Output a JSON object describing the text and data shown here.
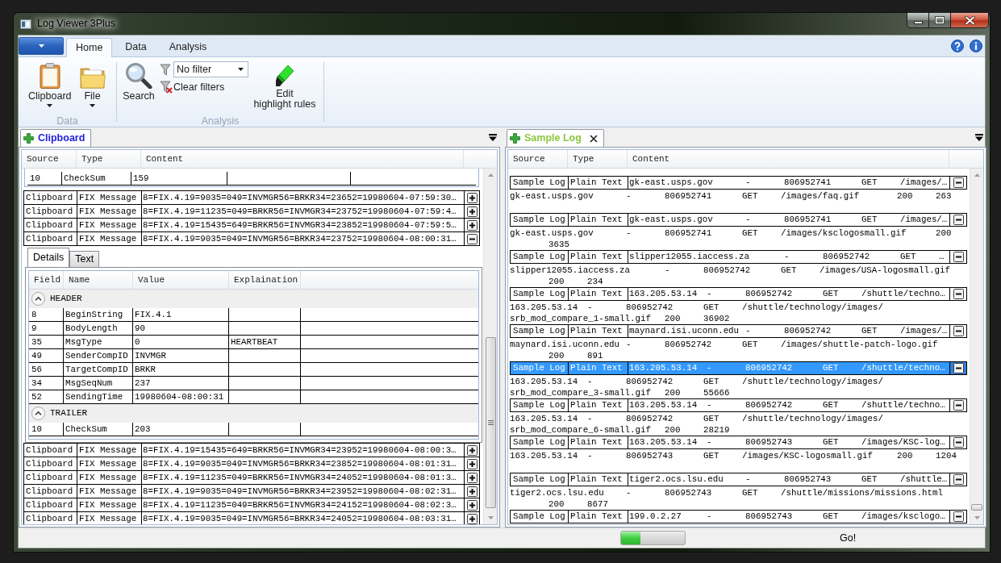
{
  "window": {
    "title": "Log Viewer 3Plus"
  },
  "ribbon": {
    "tabs": [
      {
        "label": "Home",
        "selected": true
      },
      {
        "label": "Data",
        "selected": false
      },
      {
        "label": "Analysis",
        "selected": false
      }
    ],
    "data_group": {
      "label": "Data",
      "buttons": [
        {
          "kind": "clipboard",
          "label": "Clipboard",
          "dropdown": true
        },
        {
          "kind": "folder",
          "label": "File",
          "dropdown": true
        }
      ]
    },
    "analysis_group": {
      "label": "Analysis",
      "search_button": {
        "label": "Search"
      },
      "filter_select": {
        "value": "No filter"
      },
      "clear_filters_button": {
        "label": "Clear filters"
      },
      "highlight_button": {
        "label": "Edit\nhighlight rules"
      }
    }
  },
  "left_pane": {
    "tab": {
      "label": "Clipboard",
      "color": "#1f1fdc",
      "closable": false
    },
    "columns": [
      "Source",
      "Type",
      "Content"
    ],
    "scrolled_detail_row": {
      "field": "10",
      "name": "CheckSum",
      "value": "159"
    },
    "messages": [
      {
        "source": "Clipboard",
        "type": "FIX Message",
        "content": "8=FIX.4.19=9035=049=INVMGR56=BRKR34=23652=19980604-07:59:30…",
        "expanded": false
      },
      {
        "source": "Clipboard",
        "type": "FIX Message",
        "content": "8=FIX.4.19=11235=049=BRKR56=INVMGR34=23752=19980604-07:59:4…",
        "expanded": false
      },
      {
        "source": "Clipboard",
        "type": "FIX Message",
        "content": "8=FIX.4.19=15435=649=BRKR56=INVMGR34=23852=19980604-07:59:5…",
        "expanded": false
      },
      {
        "source": "Clipboard",
        "type": "FIX Message",
        "content": "8=FIX.4.19=9035=049=INVMGR56=BRKR34=23752=19980604-08:00:31…",
        "expanded": true,
        "details": {
          "tabs": [
            {
              "label": "Details",
              "selected": true
            },
            {
              "label": "Text",
              "selected": false
            }
          ],
          "columns": [
            "Field",
            "Name",
            "Value",
            "Explaination"
          ],
          "groups": [
            {
              "label": "HEADER",
              "expanded": true,
              "rows": [
                {
                  "field": "8",
                  "name": "BeginString",
                  "value": "FIX.4.1"
                },
                {
                  "field": "9",
                  "name": "BodyLength",
                  "value": "90"
                },
                {
                  "field": "35",
                  "name": "MsgType",
                  "value": "0",
                  "explanation": "HEARTBEAT"
                },
                {
                  "field": "49",
                  "name": "SenderCompID",
                  "value": "INVMGR"
                },
                {
                  "field": "56",
                  "name": "TargetCompID",
                  "value": "BRKR"
                },
                {
                  "field": "34",
                  "name": "MsgSeqNum",
                  "value": "237"
                },
                {
                  "field": "52",
                  "name": "SendingTime",
                  "value": "19980604-08:00:31"
                }
              ]
            },
            {
              "label": "TRAILER",
              "expanded": true,
              "rows": [
                {
                  "field": "10",
                  "name": "CheckSum",
                  "value": "203"
                }
              ]
            }
          ]
        }
      },
      {
        "source": "Clipboard",
        "type": "FIX Message",
        "content": "8=FIX.4.19=15435=649=BRKR56=INVMGR34=23952=19980604-08:00:3…",
        "expanded": false
      },
      {
        "source": "Clipboard",
        "type": "FIX Message",
        "content": "8=FIX.4.19=9035=049=INVMGR56=BRKR34=23852=19980604-08:01:31…",
        "expanded": false
      },
      {
        "source": "Clipboard",
        "type": "FIX Message",
        "content": "8=FIX.4.19=11235=049=BRKR56=INVMGR34=24052=19980604-08:01:3…",
        "expanded": false
      },
      {
        "source": "Clipboard",
        "type": "FIX Message",
        "content": "8=FIX.4.19=9035=049=INVMGR56=BRKR34=23952=19980604-08:02:31…",
        "expanded": false
      },
      {
        "source": "Clipboard",
        "type": "FIX Message",
        "content": "8=FIX.4.19=11235=049=BRKR56=INVMGR34=24152=19980604-08:02:3…",
        "expanded": false
      },
      {
        "source": "Clipboard",
        "type": "FIX Message",
        "content": "8=FIX.4.19=9035=049=INVMGR56=BRKR34=24052=19980604-08:03:31…",
        "expanded": false
      }
    ]
  },
  "right_pane": {
    "tab": {
      "label": "Sample Log",
      "color": "#8cc63e",
      "closable": true
    },
    "columns": [
      "Source",
      "Type",
      "Content"
    ],
    "entries": [
      {
        "source": "Sample Log",
        "type": "Plain Text",
        "summary": "gk-east.usps.gov\t-\t806952741\tGET\t/images/…",
        "expanded": true,
        "selected": false,
        "detail": "gk-east.usps.gov\t-\t806952741\tGET\t/images/faq.gif\t200\t263"
      },
      {
        "source": "Sample Log",
        "type": "Plain Text",
        "summary": "gk-east.usps.gov\t-\t806952741\tGET\t/images/…",
        "expanded": true,
        "selected": false,
        "detail": "gk-east.usps.gov\t-\t806952741\tGET\t/images/ksclogosmall.gif\t200\n\t3635"
      },
      {
        "source": "Sample Log",
        "type": "Plain Text",
        "summary": "slipper12055.iaccess.za\t-\t806952742\tGET\t…",
        "expanded": true,
        "selected": false,
        "detail": "slipper12055.iaccess.za\t-\t806952742\tGET\t/images/USA-logosmall.gif\n\t200\t234"
      },
      {
        "source": "Sample Log",
        "type": "Plain Text",
        "summary": "163.205.53.14\t-\t806952742\tGET\t/shuttle/techno…",
        "expanded": true,
        "selected": false,
        "detail": "163.205.53.14\t-\t806952742\tGET\t/shuttle/technology/images/\nsrb_mod_compare_1-small.gif\t200\t36902"
      },
      {
        "source": "Sample Log",
        "type": "Plain Text",
        "summary": "maynard.isi.uconn.edu\t-\t806952742\tGET\t/images/…",
        "expanded": true,
        "selected": false,
        "detail": "maynard.isi.uconn.edu\t-\t806952742\tGET\t/images/shuttle-patch-logo.gif\n\t200\t891"
      },
      {
        "source": "Sample Log",
        "type": "Plain Text",
        "summary": "163.205.53.14\t-\t806952742\tGET\t/shuttle/techno…",
        "expanded": true,
        "selected": true,
        "detail": "163.205.53.14\t-\t806952742\tGET\t/shuttle/technology/images/\nsrb_mod_compare_3-small.gif\t200\t55666"
      },
      {
        "source": "Sample Log",
        "type": "Plain Text",
        "summary": "163.205.53.14\t-\t806952742\tGET\t/shuttle/techno…",
        "expanded": true,
        "selected": false,
        "detail": "163.205.53.14\t-\t806952742\tGET\t/shuttle/technology/images/\nsrb_mod_compare_6-small.gif\t200\t28219"
      },
      {
        "source": "Sample Log",
        "type": "Plain Text",
        "summary": "163.205.53.14\t-\t806952743\tGET\t/images/KSC-log…",
        "expanded": true,
        "selected": false,
        "detail": "163.205.53.14\t-\t806952743\tGET\t/images/KSC-logosmall.gif\t200\t1204"
      },
      {
        "source": "Sample Log",
        "type": "Plain Text",
        "summary": "tiger2.ocs.lsu.edu\t-\t806952743\tGET\t/shuttle…",
        "expanded": true,
        "selected": false,
        "detail": "tiger2.ocs.lsu.edu\t-\t806952743\tGET\t/shuttle/missions/missions.html\n\t200\t8677"
      },
      {
        "source": "Sample Log",
        "type": "Plain Text",
        "summary": "199.0.2.27\t-\t806952743\tGET\t/images/ksclogo…",
        "expanded": true,
        "selected": false
      }
    ]
  },
  "status_bar": {
    "progress": {
      "level": 0.3
    },
    "message": "Go!"
  }
}
